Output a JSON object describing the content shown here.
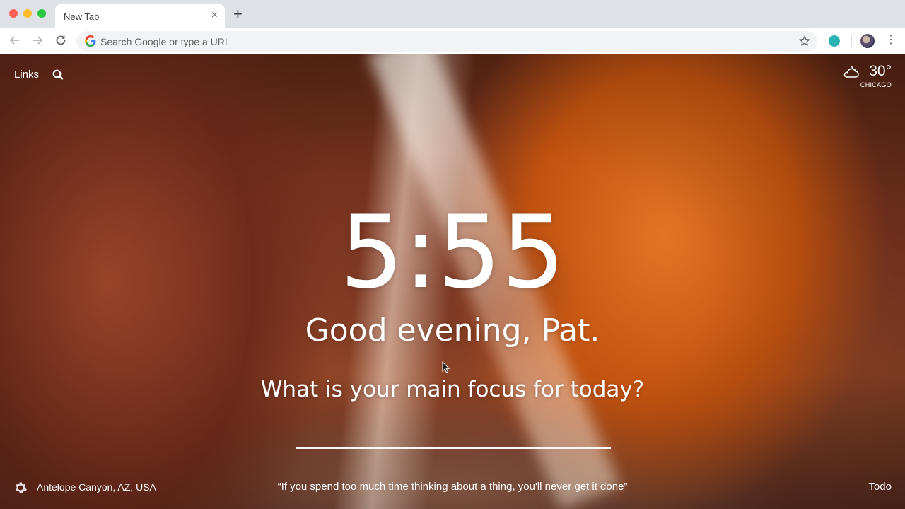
{
  "browser": {
    "tab_title": "New Tab",
    "tab_close_glyph": "×",
    "new_tab_glyph": "+",
    "omnibox_placeholder": "Search Google or type a URL",
    "icons": [
      "back-arrow-icon",
      "forward-arrow-icon",
      "reload-icon",
      "google-icon",
      "star-icon",
      "extension-icon",
      "profile-avatar",
      "menu-icon"
    ]
  },
  "dashboard": {
    "links_label": "Links",
    "weather": {
      "temperature": "30°",
      "location": "CHICAGO",
      "icon": "cloudy-night-icon"
    },
    "time": "5:55",
    "greeting": "Good evening, Pat.",
    "focus_question": "What is your main focus for today?",
    "focus_value": "",
    "photo_location": "Antelope Canyon, AZ, USA",
    "quote": "“If you spend too much time thinking about a thing, you'll never get it done”",
    "todo_label": "Todo"
  },
  "colors": {
    "chrome_titlebar": "#dee1e6",
    "chrome_toolbar": "#ffffff",
    "omnibox": "#f1f3f4",
    "extension_teal": "#2bb3b3",
    "canyon_orange": "#e27524",
    "text_white": "#ffffff"
  }
}
